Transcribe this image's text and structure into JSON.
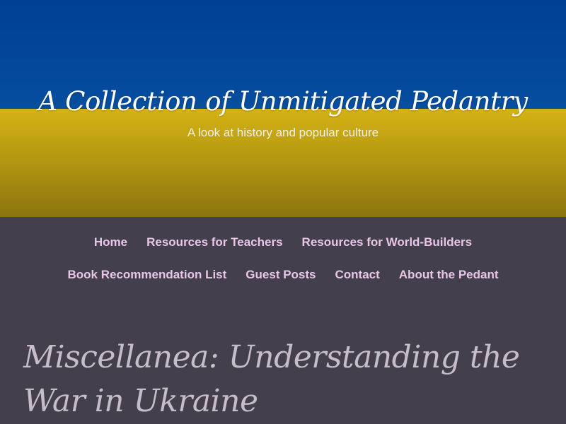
{
  "header": {
    "title": "A Collection of Unmitigated Pedantry",
    "tagline": "A look at history and popular culture",
    "banner_colors": {
      "top": "#0050a0",
      "bottom": "#d4b215"
    }
  },
  "nav": {
    "row1": [
      {
        "label": "Home"
      },
      {
        "label": "Resources for Teachers"
      },
      {
        "label": "Resources for World-Builders"
      }
    ],
    "row2": [
      {
        "label": "Book Recommendation List"
      },
      {
        "label": "Guest Posts"
      },
      {
        "label": "Contact"
      },
      {
        "label": "About the Pedant"
      }
    ]
  },
  "post": {
    "title": "Miscellanea: Understanding the War in Ukraine"
  }
}
